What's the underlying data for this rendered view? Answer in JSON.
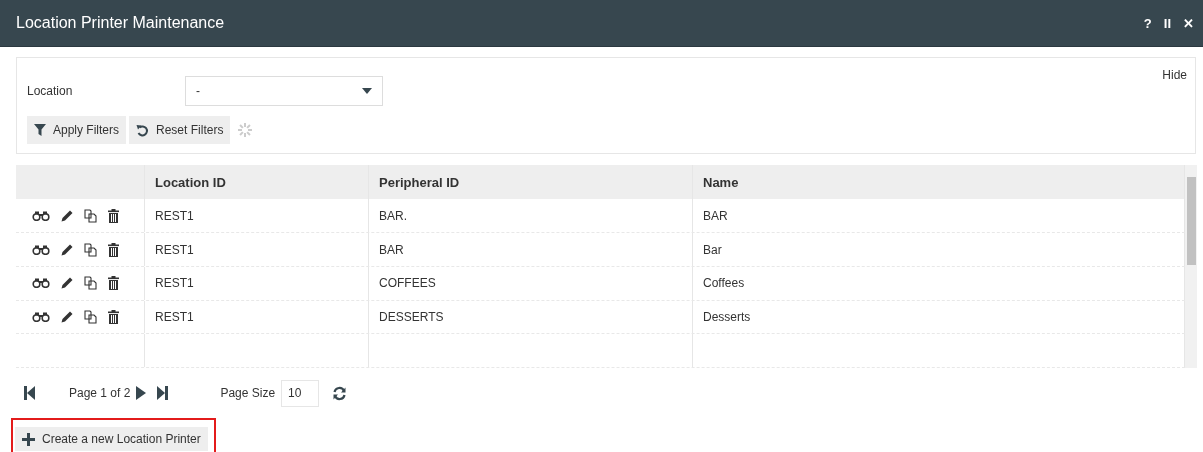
{
  "window": {
    "title": "Location Printer Maintenance",
    "controls": [
      "?",
      "II",
      "✕"
    ]
  },
  "filters": {
    "hide_link": "Hide",
    "fields": [
      {
        "label": "Location",
        "value": "-"
      }
    ],
    "buttons": [
      {
        "kind": "filter",
        "label": "Apply Filters"
      },
      {
        "kind": "reset",
        "label": "Reset Filters"
      }
    ],
    "loading": true
  },
  "table": {
    "columns": [
      "Location ID",
      "Peripheral ID",
      "Name"
    ],
    "rows": [
      [
        "REST1",
        "BAR.",
        "BAR"
      ],
      [
        "REST1",
        "BAR",
        "Bar"
      ],
      [
        "REST1",
        "COFFEES",
        "Coffees"
      ],
      [
        "REST1",
        "DESSERTS",
        "Desserts"
      ]
    ]
  },
  "pager": {
    "page_text": "Page 1 of 2",
    "page_size_label": "Page Size",
    "page_size": "10"
  },
  "create_button": {
    "label": "Create a new Location Printer",
    "highlighted": true
  }
}
